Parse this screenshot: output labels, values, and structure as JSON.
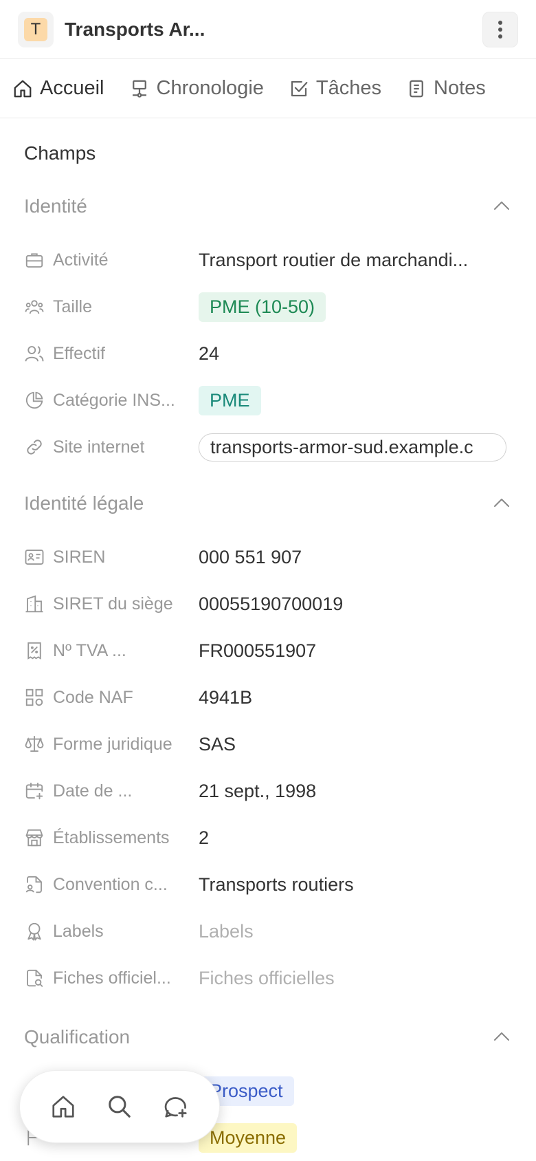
{
  "header": {
    "avatar_letter": "T",
    "title": "Transports Ar...",
    "more_icon": "dots-vertical-icon"
  },
  "tabs": [
    {
      "label": "Accueil",
      "icon": "home-icon",
      "active": true
    },
    {
      "label": "Chronologie",
      "icon": "timeline-icon",
      "active": false
    },
    {
      "label": "Tâches",
      "icon": "checkbox-icon",
      "active": false
    },
    {
      "label": "Notes",
      "icon": "notes-icon",
      "active": false
    }
  ],
  "fields_title": "Champs",
  "sections": {
    "identity": {
      "title": "Identité",
      "rows": {
        "activity": {
          "label": "Activité",
          "value": "Transport routier de marchandi..."
        },
        "size": {
          "label": "Taille",
          "value": "PME (10-50)"
        },
        "headcount": {
          "label": "Effectif",
          "value": "24"
        },
        "insee_category": {
          "label": "Catégorie INS...",
          "value": "PME"
        },
        "website": {
          "label": "Site internet",
          "value": "transports-armor-sud.example.c"
        }
      }
    },
    "legal": {
      "title": "Identité légale",
      "rows": {
        "siren": {
          "label": "SIREN",
          "value": "000 551 907"
        },
        "siret": {
          "label": "SIRET du siège",
          "value": "00055190700019"
        },
        "vat": {
          "label": "Nº TVA ...",
          "value": "FR000551907"
        },
        "naf": {
          "label": "Code NAF",
          "value": "4941B"
        },
        "legal_form": {
          "label": "Forme juridique",
          "value": "SAS"
        },
        "creation_date": {
          "label": "Date de ...",
          "value": "21 sept., 1998"
        },
        "establishments": {
          "label": "Établissements",
          "value": "2"
        },
        "convention": {
          "label": "Convention c...",
          "value": "Transports routiers"
        },
        "labels": {
          "label": "Labels",
          "placeholder": "Labels"
        },
        "official_records": {
          "label": "Fiches officiel...",
          "placeholder": "Fiches officielles"
        }
      }
    },
    "qualification": {
      "title": "Qualification",
      "rows": {
        "status": {
          "value": "Prospect"
        },
        "priority": {
          "value": "Moyenne"
        }
      }
    }
  },
  "colors": {
    "chip_green_bg": "#e6f5ec",
    "chip_green_text": "#1e8a55",
    "chip_teal_bg": "#e2f6f2",
    "chip_blue_bg": "#e9effd",
    "chip_yellow_bg": "#fdf7c3",
    "avatar_bg": "#fcd9a8"
  },
  "bottom_nav": {
    "icons": [
      "home-icon",
      "search-icon",
      "new-chat-icon"
    ]
  }
}
